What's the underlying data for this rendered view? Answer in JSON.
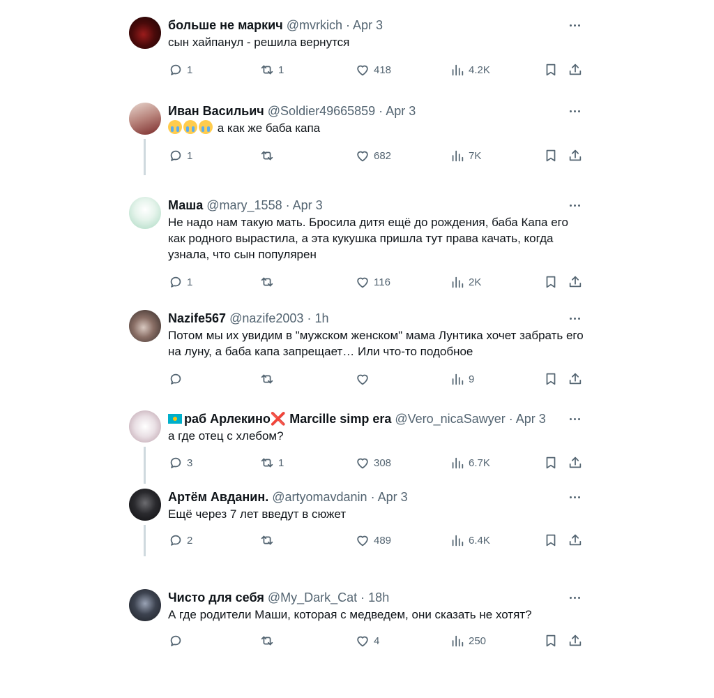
{
  "replies": [
    {
      "name": "больше не маркич",
      "handle": "@mvrkich",
      "time": "Apr 3",
      "text": "сын хайпанул - решила вернутся",
      "reply": "1",
      "retweet": "1",
      "like": "418",
      "views": "4.2K",
      "avatar_color": "#3a0a0a"
    },
    {
      "name": "Иван Васильич",
      "handle": "@Soldier49665859",
      "time": "Apr 3",
      "text": "а как же баба капа",
      "reply": "1",
      "retweet": "",
      "like": "682",
      "views": "7K",
      "avatar_color": "#c9a18e"
    },
    {
      "name": "Маша",
      "handle": "@mary_1558",
      "time": "Apr 3",
      "text": "Не надо нам такую мать. Бросила дитя ещё до рождения, баба Капа его как родного вырастила, а эта кукушка пришла тут права качать, когда узнала, что сын популярен",
      "reply": "1",
      "retweet": "",
      "like": "116",
      "views": "2K",
      "avatar_color": "#d6efe3"
    },
    {
      "name": "Nazife567",
      "handle": "@nazife2003",
      "time": "1h",
      "text": "Потом мы их увидим в \"мужском женском\" мама Лунтика хочет забрать его на луну, а баба капа запрещает… Или что-то подобное",
      "reply": "",
      "retweet": "",
      "like": "",
      "views": "9",
      "avatar_color": "#5a4a44"
    },
    {
      "name_pre": "раб Арлекино",
      "name_post": "Marcille simp era",
      "cross": "❌",
      "handle": "@Vero_nicaSawyer",
      "time": "Apr 3",
      "text": "а где отец с хлебом?",
      "reply": "3",
      "retweet": "1",
      "like": "308",
      "views": "6.7K",
      "avatar_color": "#e6dce0"
    },
    {
      "name": "Артём Авданин.",
      "handle": "@artyomavdanin",
      "time": "Apr 3",
      "text": "Ещё через 7 лет введут в сюжет",
      "reply": "2",
      "retweet": "",
      "like": "489",
      "views": "6.4K",
      "avatar_color": "#1d1d1f"
    },
    {
      "name": "Чисто для себя",
      "handle": "@My_Dark_Cat",
      "time": "18h",
      "text": "А где родители Маши, которая с медведем, они сказать не хотят?",
      "reply": "",
      "retweet": "",
      "like": "4",
      "views": "250",
      "avatar_color": "#2f3440"
    }
  ]
}
